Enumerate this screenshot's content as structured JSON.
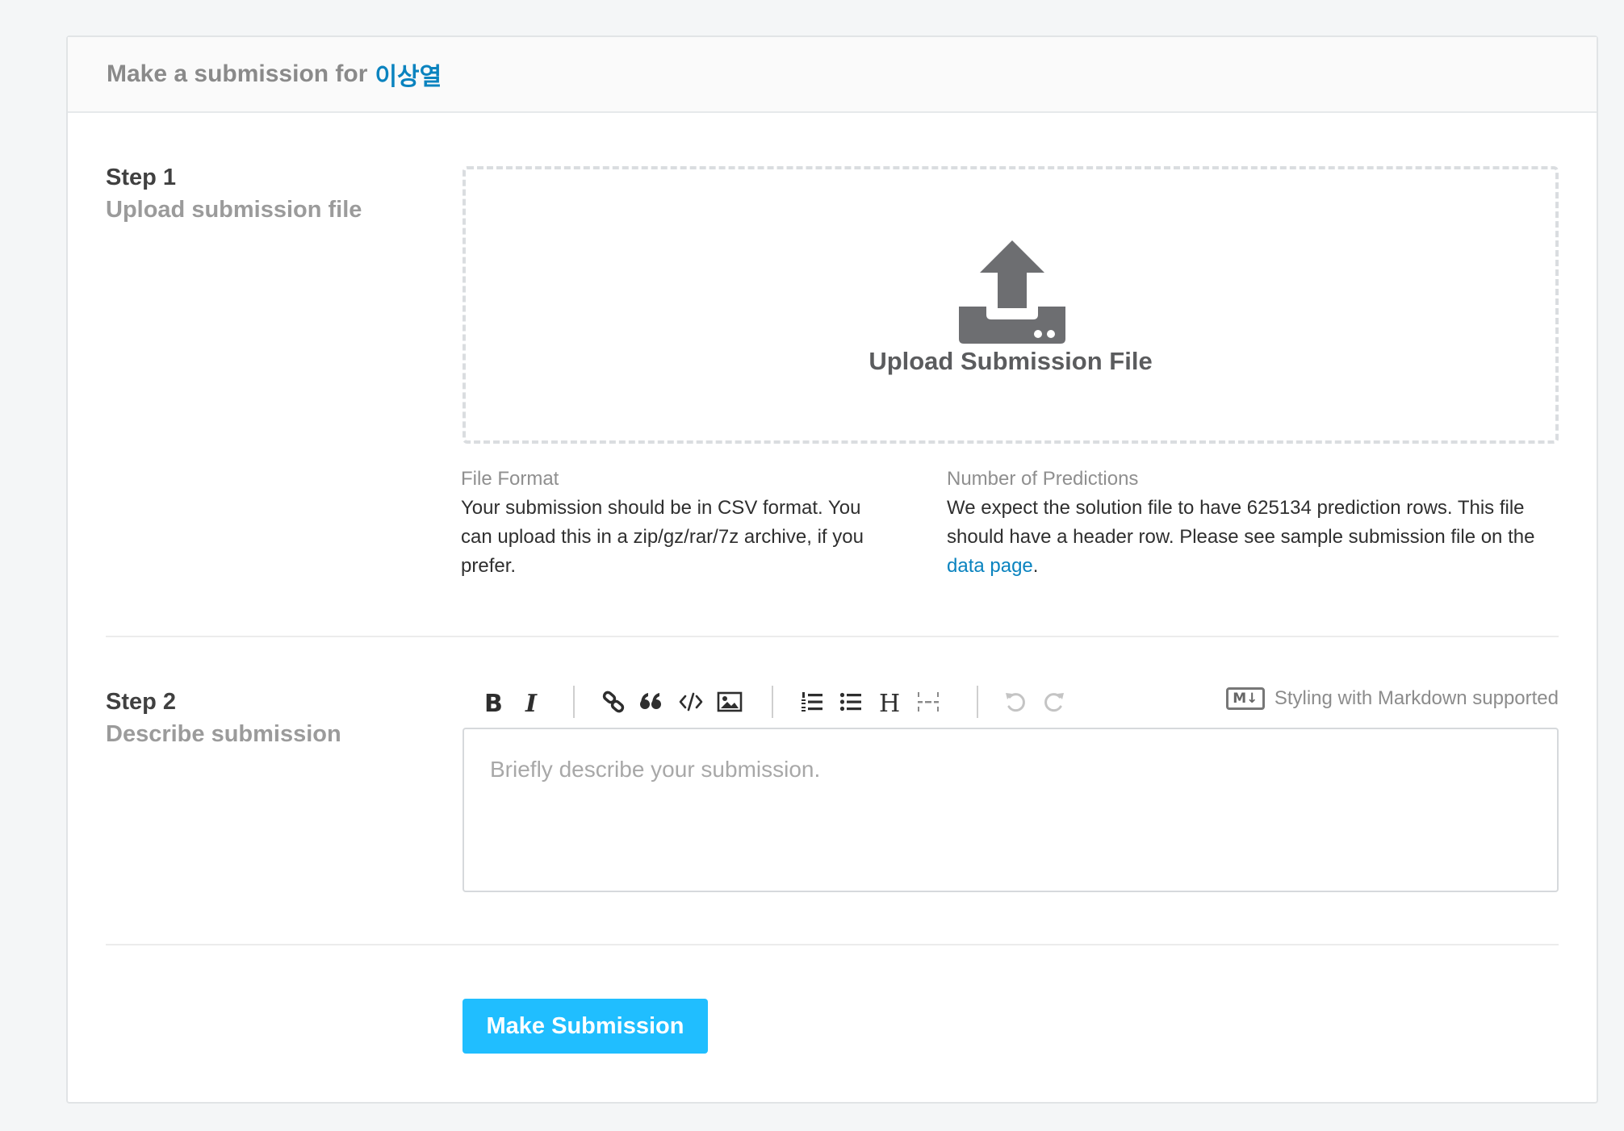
{
  "header": {
    "title_prefix": "Make a submission for",
    "user_name": "이상열"
  },
  "step1": {
    "number": "Step 1",
    "subtitle": "Upload submission file",
    "upload_label": "Upload Submission File",
    "file_format": {
      "title": "File Format",
      "body": "Your submission should be in CSV format. You can upload this in a zip/gz/rar/7z archive, if you prefer."
    },
    "predictions": {
      "title": "Number of Predictions",
      "body_before": "We expect the solution file to have 625134 prediction rows. This file should have a header row. Please see sample submission file on the",
      "link": "data page",
      "body_after": "."
    }
  },
  "step2": {
    "number": "Step 2",
    "subtitle": "Describe submission",
    "placeholder": "Briefly describe your submission.",
    "markdown_badge": "M↓",
    "markdown_note": "Styling with Markdown supported",
    "toolbar": [
      "bold-icon",
      "italic-icon",
      "link-icon",
      "quote-icon",
      "code-icon",
      "image-icon",
      "ordered-list-icon",
      "unordered-list-icon",
      "heading-icon",
      "horizontal-rule-icon",
      "undo-icon",
      "redo-icon"
    ]
  },
  "actions": {
    "submit_label": "Make Submission"
  },
  "colors": {
    "accent": "#20beff",
    "link": "#0a83bf",
    "icon": "#6d6e71"
  }
}
